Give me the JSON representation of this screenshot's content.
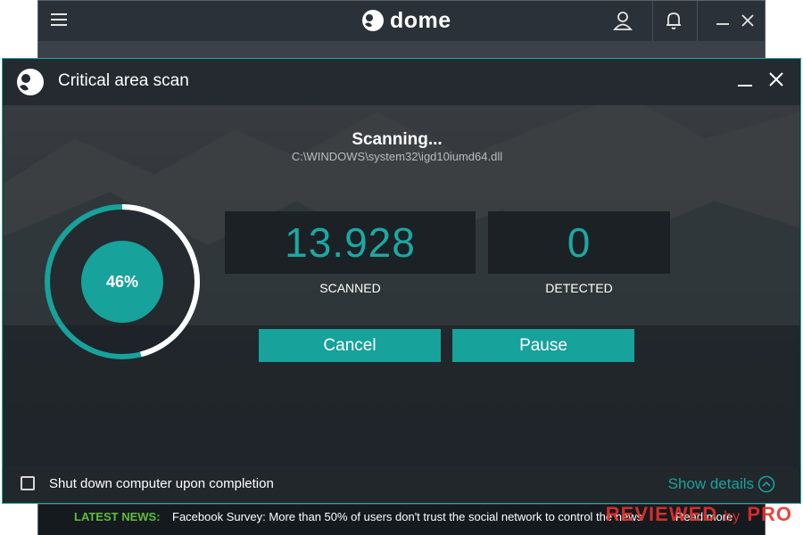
{
  "main_app": {
    "logo_text": "dome",
    "icons": {
      "menu": "hamburger-menu-icon",
      "account": "user-icon",
      "notifications": "bell-icon",
      "minimize": "minimize-icon",
      "close": "close-icon"
    }
  },
  "dialog": {
    "title": "Critical area scan",
    "scanning_text": "Scanning...",
    "current_file": "C:\\WINDOWS\\system32\\igd10iumd64.dll",
    "progress_percent": 46,
    "progress_label": "46%",
    "stats": {
      "scanned_value": "13.928",
      "scanned_label": "SCANNED",
      "detected_value": "0",
      "detected_label": "DETECTED"
    },
    "buttons": {
      "cancel": "Cancel",
      "pause": "Pause"
    },
    "footer": {
      "shutdown_label": "Shut down computer upon completion",
      "shutdown_checked": false,
      "show_details": "Show details"
    }
  },
  "news": {
    "label": "LATEST NEWS:",
    "text": "Facebook Survey: More than 50% of users don't trust the social network to control the news",
    "read_more": "Read more"
  },
  "watermark": {
    "main": "REVIEWED",
    "by": "by",
    "pro": "PRO"
  },
  "colors": {
    "accent": "#17a29b",
    "news_label": "#5cbf3a",
    "watermark": "#e8302e"
  }
}
